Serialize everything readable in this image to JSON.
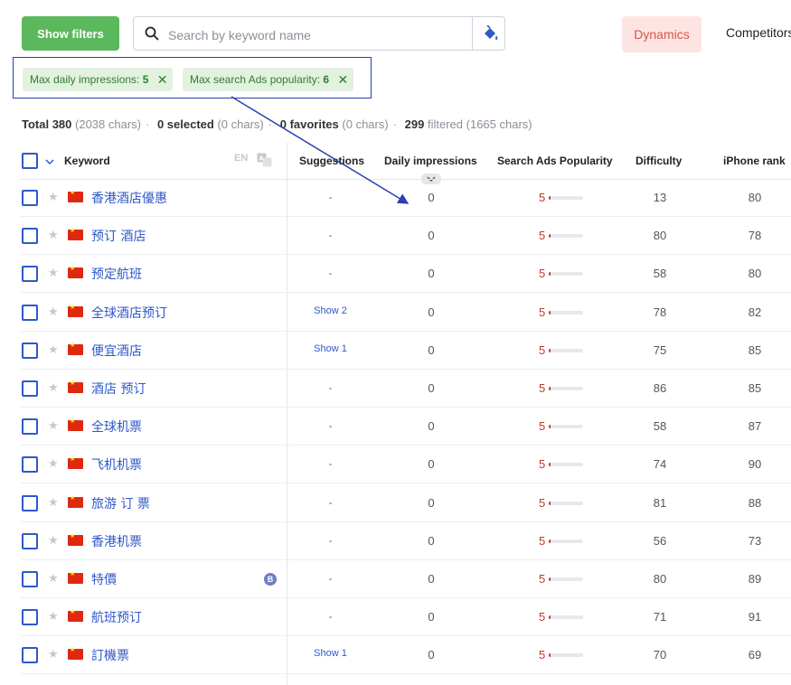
{
  "toolbar": {
    "show_filters_label": "Show filters",
    "search_placeholder": "Search by keyword name",
    "dynamics_label": "Dynamics",
    "competitors_label": "Competitors"
  },
  "filters": [
    {
      "label": "Max daily impressions:",
      "value": "5"
    },
    {
      "label": "Max search Ads popularity:",
      "value": "6"
    }
  ],
  "totals": {
    "total_label": "Total 380",
    "total_chars": "(2038 chars)",
    "selected_label": "0 selected",
    "selected_chars": "(0 chars)",
    "favorites_label": "0 favorites",
    "favorites_chars": "(0 chars)",
    "filtered_count": "299",
    "filtered_label": "filtered (1665 chars)"
  },
  "table": {
    "headers": {
      "keyword": "Keyword",
      "lang": "EN",
      "suggestions": "Suggestions",
      "daily": "Daily impressions",
      "popularity": "Search Ads Popularity",
      "difficulty": "Difficulty",
      "iphone_rank": "iPhone rank"
    },
    "popularity_max": 100,
    "rows": [
      {
        "keyword": "香港酒店優惠",
        "suggestions": "-",
        "daily": "0",
        "popularity": "5",
        "difficulty": "13",
        "rank": "80"
      },
      {
        "keyword": "预订 酒店",
        "suggestions": "-",
        "daily": "0",
        "popularity": "5",
        "difficulty": "80",
        "rank": "78"
      },
      {
        "keyword": "预定航班",
        "suggestions": "-",
        "daily": "0",
        "popularity": "5",
        "difficulty": "58",
        "rank": "80"
      },
      {
        "keyword": "全球酒店预订",
        "suggestions": "Show 2",
        "daily": "0",
        "popularity": "5",
        "difficulty": "78",
        "rank": "82"
      },
      {
        "keyword": "便宜酒店",
        "suggestions": "Show 1",
        "daily": "0",
        "popularity": "5",
        "difficulty": "75",
        "rank": "85"
      },
      {
        "keyword": "酒店 预订",
        "suggestions": "-",
        "daily": "0",
        "popularity": "5",
        "difficulty": "86",
        "rank": "85"
      },
      {
        "keyword": "全球机票",
        "suggestions": "-",
        "daily": "0",
        "popularity": "5",
        "difficulty": "58",
        "rank": "87"
      },
      {
        "keyword": "飞机机票",
        "suggestions": "-",
        "daily": "0",
        "popularity": "5",
        "difficulty": "74",
        "rank": "90"
      },
      {
        "keyword": "旅游 订 票",
        "suggestions": "-",
        "daily": "0",
        "popularity": "5",
        "difficulty": "81",
        "rank": "88"
      },
      {
        "keyword": "香港机票",
        "suggestions": "-",
        "daily": "0",
        "popularity": "5",
        "difficulty": "56",
        "rank": "73"
      },
      {
        "keyword": "特價",
        "badge": "B",
        "suggestions": "-",
        "daily": "0",
        "popularity": "5",
        "difficulty": "80",
        "rank": "89"
      },
      {
        "keyword": "航班预订",
        "suggestions": "-",
        "daily": "0",
        "popularity": "5",
        "difficulty": "71",
        "rank": "91"
      },
      {
        "keyword": "訂機票",
        "suggestions": "Show 1",
        "daily": "0",
        "popularity": "5",
        "difficulty": "70",
        "rank": "69"
      }
    ]
  },
  "colors": {
    "accent_green": "#5cb85c",
    "link_blue": "#2f58c9",
    "dynamics_bg": "#fde4e2",
    "dynamics_text": "#d9534f",
    "popularity_red": "#c0392b",
    "annotation_blue": "#2940b0"
  },
  "icons": {
    "search": "search-icon",
    "paint": "paint-bucket-icon",
    "remove": "close-icon",
    "star": "star-icon",
    "flag": "china-flag-icon",
    "translate": "translate-icon",
    "sort": "chevron-down-icon"
  }
}
